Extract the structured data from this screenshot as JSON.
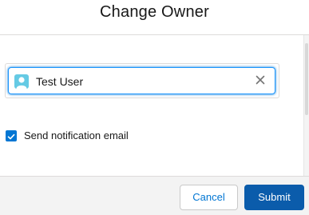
{
  "modal": {
    "title": "Change Owner"
  },
  "owner_lookup": {
    "selected_user": "Test User",
    "avatar_icon": "user-avatar-icon",
    "remove_icon": "close-icon"
  },
  "notification": {
    "checkbox_checked": true,
    "label": "Send notification email"
  },
  "footer": {
    "cancel_label": "Cancel",
    "submit_label": "Submit"
  },
  "colors": {
    "brand_blue": "#0176d3",
    "submit_bg": "#0b5cab",
    "avatar_bg": "#65cae4",
    "footer_bg": "#f3f3f3"
  }
}
